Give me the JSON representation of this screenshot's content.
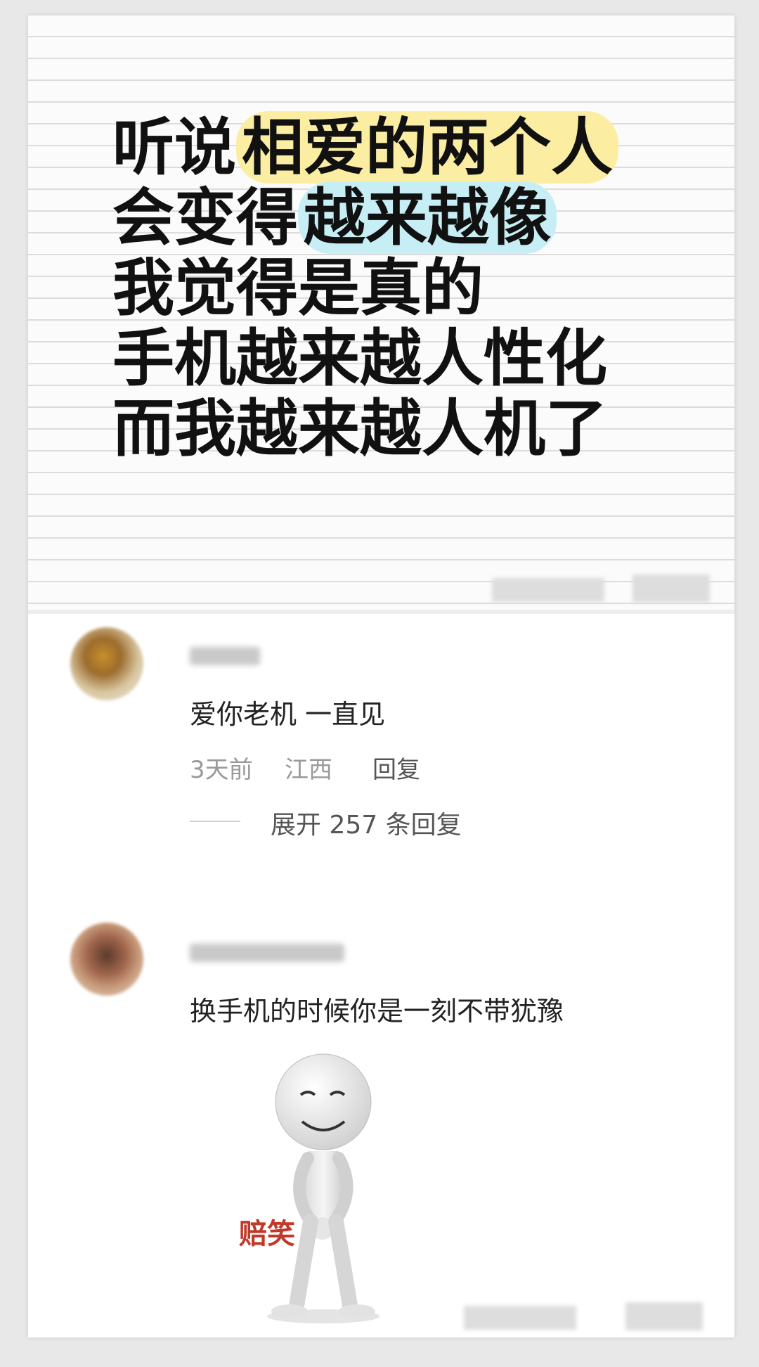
{
  "post": {
    "lines": [
      {
        "plain_before": "听说",
        "highlight": "相爱的两个人",
        "highlight_color": "#fbeea3",
        "plain_after": ""
      },
      {
        "plain_before": "会变得",
        "highlight": "越来越像",
        "highlight_color": "#c6eef4",
        "plain_after": ""
      },
      {
        "plain_before": "我觉得是真的",
        "highlight": "",
        "plain_after": ""
      },
      {
        "plain_before": "手机越来越人性化",
        "highlight": "",
        "plain_after": ""
      },
      {
        "plain_before": "而我越来越人机了",
        "highlight": "",
        "plain_after": ""
      }
    ]
  },
  "comments": [
    {
      "text": "爱你老机 一直见",
      "time": "3天前",
      "location": "江西",
      "reply_label": "回复",
      "expand_label": "展开 257 条回复"
    },
    {
      "text": "换手机的时候你是一刻不带犹豫",
      "sticker_label": "赔笑"
    }
  ],
  "colors": {
    "highlight_yellow": "#fbeea3",
    "highlight_blue": "#c6eef4",
    "sticker_label": "#c0392b"
  }
}
